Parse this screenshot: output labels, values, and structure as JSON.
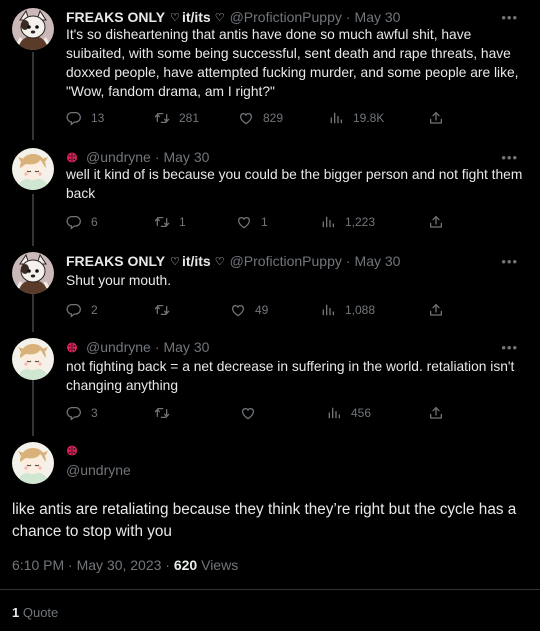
{
  "tweets": [
    {
      "name": "FREAKS ONLY",
      "name_heart": "♡",
      "pronouns": "it/its",
      "handle_heart": "♡",
      "handle": "@ProfictionPuppy",
      "time": "May 30",
      "more": "•••",
      "text": "It's so disheartening that antis have done so much awful shit, have suibaited, with some being successful, sent death and rape threats, have doxxed people, have attempted fucking murder, and some people are like, \"Wow, fandom drama, am I right?\"",
      "replies": "13",
      "retweets": "281",
      "likes": "829",
      "views": "19.8K"
    },
    {
      "handle": "@undryne",
      "time": "May 30",
      "more": "•••",
      "text": "well it kind of is because you could be the bigger person and not fight them back",
      "replies": "6",
      "retweets": "1",
      "likes": "1",
      "views": "1,223"
    },
    {
      "name": "FREAKS ONLY",
      "name_heart": "♡",
      "pronouns": "it/its",
      "handle_heart": "♡",
      "handle": "@ProfictionPuppy",
      "time": "May 30",
      "more": "•••",
      "text": "Shut your mouth.",
      "replies": "2",
      "retweets": "",
      "likes": "49",
      "views": "1,088"
    },
    {
      "handle": "@undryne",
      "time": "May 30",
      "more": "•••",
      "text": "not fighting back = a net decrease in suffering in the world. retaliation isn't changing anything",
      "replies": "3",
      "retweets": "",
      "likes": "",
      "views": "456"
    }
  ],
  "main_tweet": {
    "handle": "@undryne",
    "text": "like antis are retaliating because they think they’re right but the cycle has a chance to stop with you",
    "timestamp": "6:10 PM · May 30, 2023 · ",
    "views_count": "620",
    "views_label": " Views",
    "quote_count": "1",
    "quote_label": " Quote"
  },
  "colors": {
    "background": "#000000",
    "text": "#e7e9ea",
    "muted": "#71767b",
    "thread_line": "#333639",
    "divider": "#2f3336",
    "ladybug": "#e0245e"
  }
}
